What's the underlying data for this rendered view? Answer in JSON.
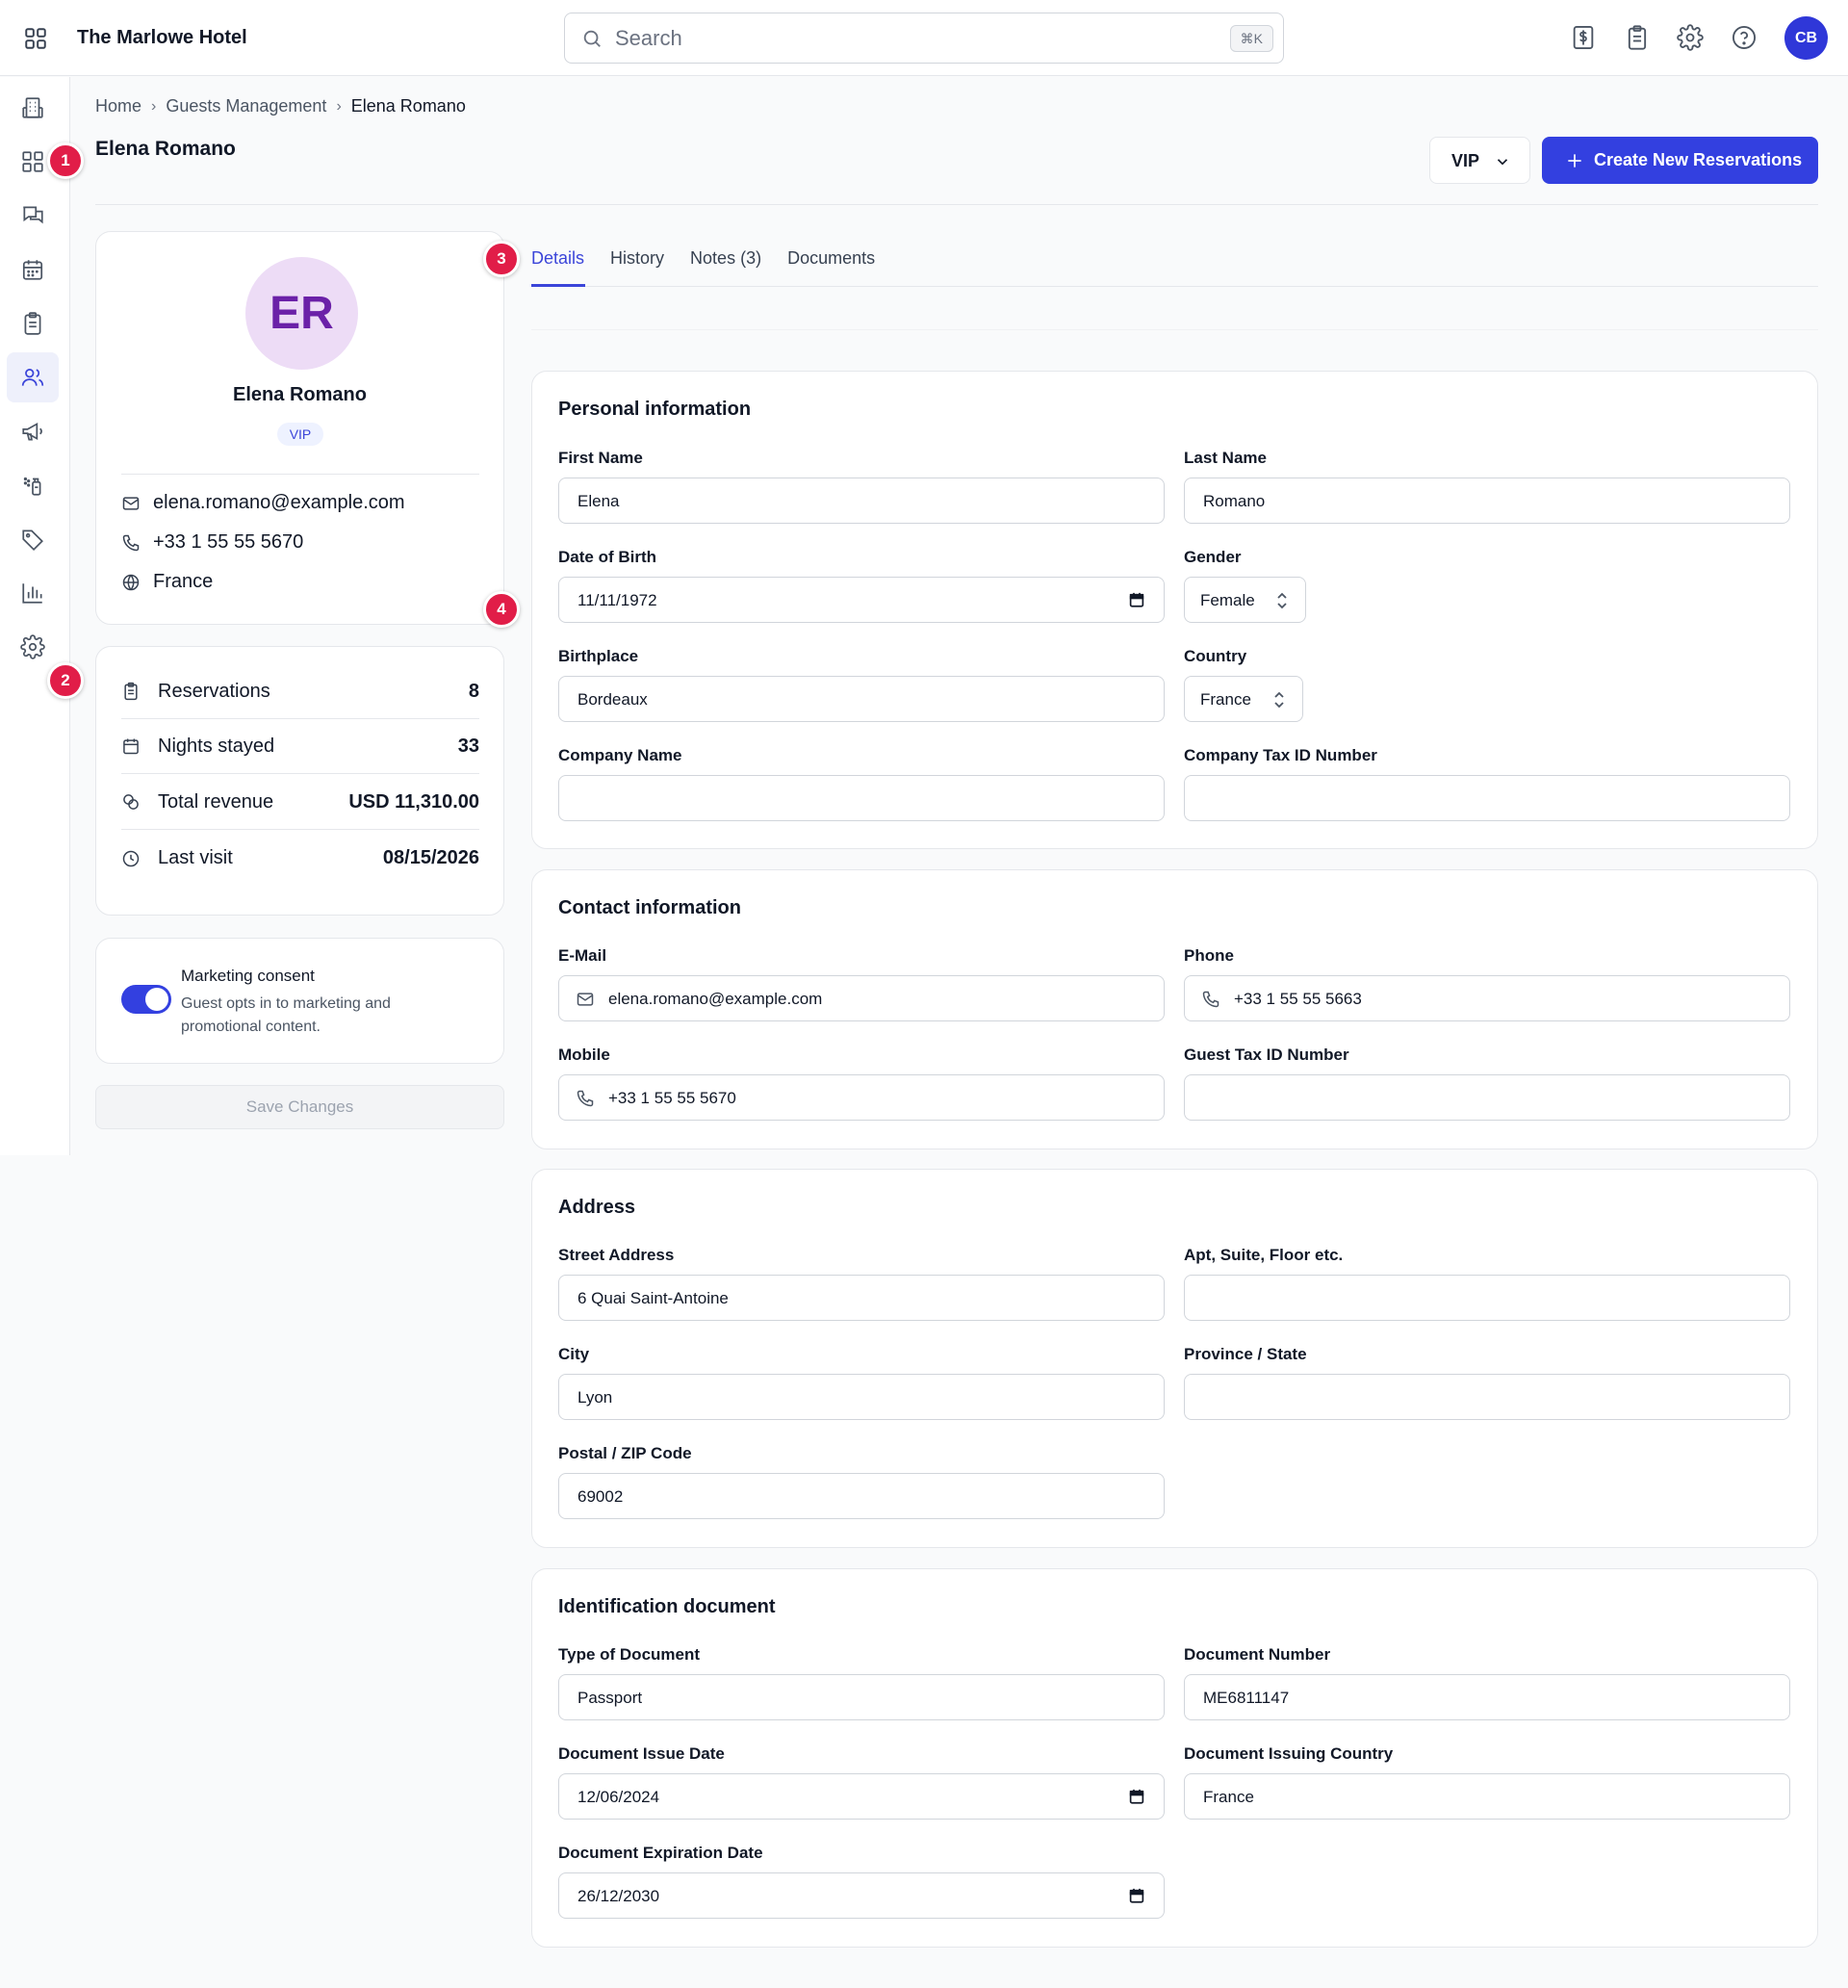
{
  "topbar": {
    "hotel_name": "The Marlowe Hotel",
    "search_placeholder": "Search",
    "search_shortcut": "⌘K",
    "avatar_initials": "CB",
    "icons": [
      "dollar-receipt-icon",
      "clipboard-icon",
      "gear-icon",
      "help-icon"
    ]
  },
  "sidebar": {
    "items": [
      {
        "name": "hotel-building-icon"
      },
      {
        "name": "dashboard-grid-icon"
      },
      {
        "name": "chat-icon"
      },
      {
        "name": "calendar-icon"
      },
      {
        "name": "clipboard-icon"
      },
      {
        "name": "guests-icon",
        "active": true
      },
      {
        "name": "megaphone-icon"
      },
      {
        "name": "housekeeping-icon"
      },
      {
        "name": "tag-icon"
      },
      {
        "name": "reports-chart-icon"
      },
      {
        "name": "settings-gear-icon"
      }
    ]
  },
  "markers": [
    "1",
    "2",
    "3",
    "4"
  ],
  "breadcrumb": {
    "home": "Home",
    "section": "Guests Management",
    "current": "Elena Romano"
  },
  "header": {
    "title": "Elena Romano",
    "tier_select": "VIP",
    "create_button": "Create New Reservations"
  },
  "profile": {
    "initials": "ER",
    "name": "Elena Romano",
    "badge": "VIP",
    "email": "elena.romano@example.com",
    "phone": "+33 1 55 55 5670",
    "country": "France"
  },
  "stats": [
    {
      "label": "Reservations",
      "value": "8"
    },
    {
      "label": "Nights stayed",
      "value": "33"
    },
    {
      "label": "Total revenue",
      "value": "USD 11,310.00"
    },
    {
      "label": "Last visit",
      "value": "08/15/2026"
    }
  ],
  "consent": {
    "title": "Marketing consent",
    "description": "Guest opts in to marketing and promotional content.",
    "enabled": true
  },
  "save_button": "Save Changes",
  "tabs": [
    "Details",
    "History",
    "Notes (3)",
    "Documents"
  ],
  "personal": {
    "title": "Personal information",
    "first_name_label": "First Name",
    "first_name": "Elena",
    "last_name_label": "Last Name",
    "last_name": "Romano",
    "dob_label": "Date of Birth",
    "dob": "11/11/1972",
    "gender_label": "Gender",
    "gender": "Female",
    "birthplace_label": "Birthplace",
    "birthplace": "Bordeaux",
    "country_label": "Country",
    "country": "France",
    "company_label": "Company Name",
    "company": "",
    "company_tax_label": "Company Tax ID Number",
    "company_tax": ""
  },
  "contact": {
    "title": "Contact information",
    "email_label": "E-Mail",
    "email": "elena.romano@example.com",
    "phone_label": "Phone",
    "phone": "+33 1 55 55 5663",
    "mobile_label": "Mobile",
    "mobile": "+33 1 55 55 5670",
    "guest_tax_label": "Guest Tax ID Number",
    "guest_tax": ""
  },
  "address": {
    "title": "Address",
    "street_label": "Street Address",
    "street": "6 Quai Saint-Antoine",
    "apt_label": "Apt, Suite, Floor etc.",
    "apt": "",
    "city_label": "City",
    "city": "Lyon",
    "province_label": "Province / State",
    "province": "",
    "postal_label": "Postal / ZIP Code",
    "postal": "69002"
  },
  "identification": {
    "title": "Identification document",
    "type_label": "Type of Document",
    "type": "Passport",
    "number_label": "Document Number",
    "number": "ME6811147",
    "issue_label": "Document Issue Date",
    "issue": "12/06/2024",
    "issuing_country_label": "Document Issuing Country",
    "issuing_country": "France",
    "expiration_label": "Document Expiration Date",
    "expiration": "26/12/2030"
  },
  "colors": {
    "accent": "#3340e0",
    "marker": "#e11d48",
    "avatar_bg": "#eddcf6",
    "avatar_text": "#6b21a8"
  }
}
